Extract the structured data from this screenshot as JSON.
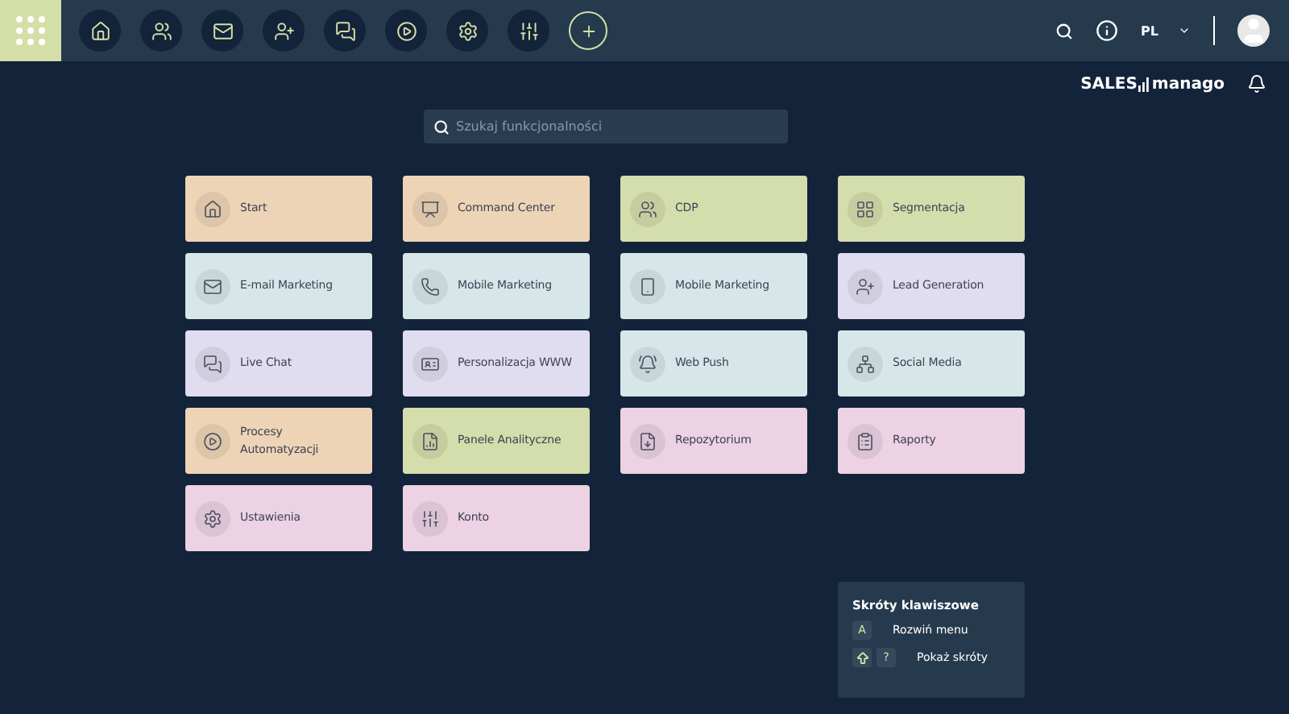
{
  "top_bar": {
    "language": "PL"
  },
  "logo": {
    "left": "SALES",
    "right": "manago"
  },
  "search": {
    "placeholder": "Szukaj funkcjonalności"
  },
  "columns": [
    [
      {
        "label": "Start",
        "color": "#eed4b6"
      },
      {
        "label": "E-mail Marketing",
        "color": "#d7e7e9"
      },
      {
        "label": "Live Chat",
        "color": "#e0ddf0"
      },
      {
        "label": "Procesy Automatyzacji",
        "color": "#eed4b6"
      },
      {
        "label": "Ustawienia",
        "color": "#ecd2e3"
      }
    ],
    [
      {
        "label": "Command Center",
        "color": "#eed4b6"
      },
      {
        "label": "Mobile Marketing",
        "color": "#d7e7e9"
      },
      {
        "label": "Personalizacja WWW",
        "color": "#e0ddf0"
      },
      {
        "label": "Panele Analityczne",
        "color": "#d4ddac"
      },
      {
        "label": "Konto",
        "color": "#ecd2e3"
      }
    ],
    [
      {
        "label": "CDP",
        "color": "#d4ddac"
      },
      {
        "label": "Mobile Marketing",
        "color": "#d7e7e9"
      },
      {
        "label": "Web Push",
        "color": "#d7e7e9"
      },
      {
        "label": "Repozytorium",
        "color": "#ecd2e3"
      }
    ],
    [
      {
        "label": "Segmentacja",
        "color": "#d4ddac"
      },
      {
        "label": "Lead Generation",
        "color": "#e0ddf0"
      },
      {
        "label": "Social Media",
        "color": "#d7e7e9"
      },
      {
        "label": "Raporty",
        "color": "#ecd2e3"
      }
    ]
  ],
  "shortcuts": {
    "title": "Skróty klawiszowe",
    "items": [
      {
        "keys": [
          {
            "kind": "text",
            "label": "A"
          }
        ],
        "label": "Rozwiń menu"
      },
      {
        "keys": [
          {
            "kind": "shift"
          },
          {
            "kind": "text",
            "label": "?"
          }
        ],
        "label": "Pokaż skróty"
      }
    ]
  }
}
